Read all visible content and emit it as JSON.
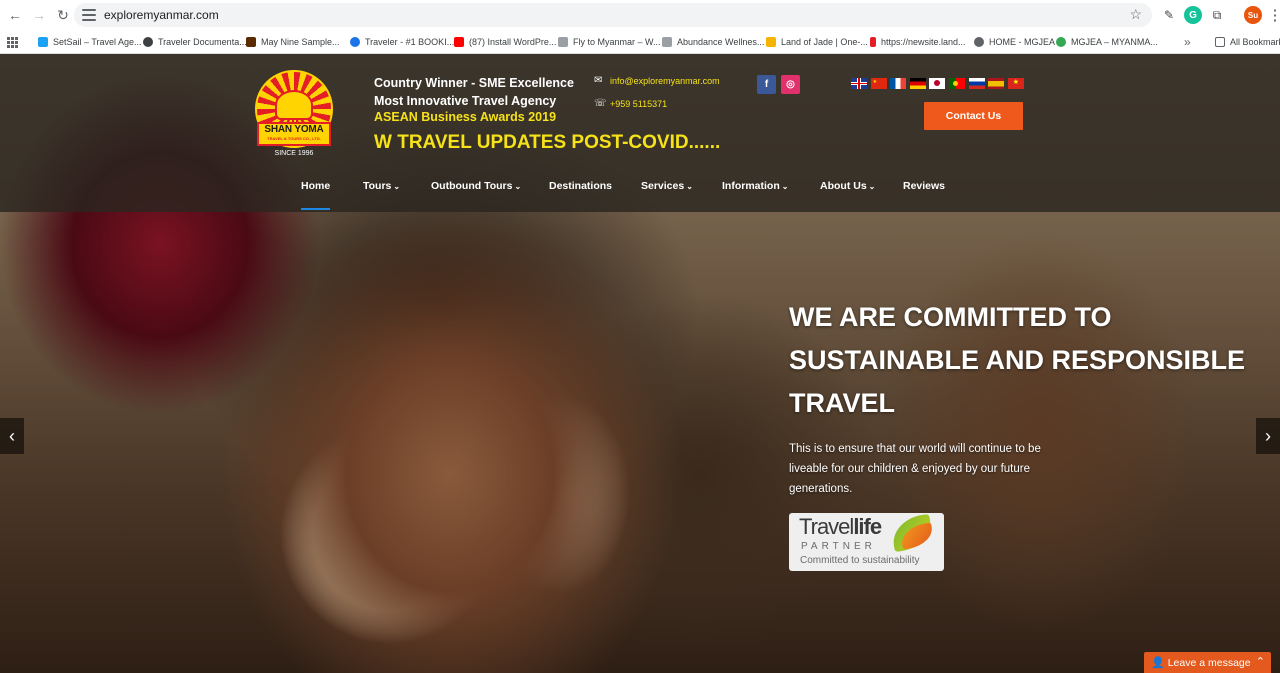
{
  "browser": {
    "url": "exploremyanmar.com",
    "profile_initials": "Su",
    "bookmarks": [
      {
        "label": "SetSail – Travel Age...",
        "color": "#1da1f2"
      },
      {
        "label": "Traveler Documenta...",
        "color": "#3c4043"
      },
      {
        "label": "May Nine Sample...",
        "color": "#5a2a00"
      },
      {
        "label": "Traveler - #1 BOOKI...",
        "color": "#1a73e8"
      },
      {
        "label": "(87) Install WordPre...",
        "color": "#ff0000"
      },
      {
        "label": "Fly to Myanmar – W...",
        "color": "#9aa0a6"
      },
      {
        "label": "Abundance Wellnes...",
        "color": "#9aa0a6"
      },
      {
        "label": "Land of Jade | One-...",
        "color": "#f4b400"
      },
      {
        "label": "https://newsite.land...",
        "color": "#e41e26"
      },
      {
        "label": "HOME - MGJEA",
        "color": "#5f6368"
      },
      {
        "label": "MGJEA – MYANMA...",
        "color": "#34a853"
      }
    ],
    "all_bookmarks_label": "All Bookmarks"
  },
  "header": {
    "logo_brand": "SHAN YOMA",
    "logo_sub": "TRAVEL & TOURS CO., LTD.",
    "logo_since": "SINCE 1996",
    "award_line1": "Country Winner - SME Excellence",
    "award_line2": "Most Innovative Travel Agency",
    "award_line3": "ASEAN Business Awards 2019",
    "covid_marquee": "W TRAVEL UPDATES POST-COVID......",
    "email": "info@exploremyanmar.com",
    "phone": "+959 5115371",
    "contact_button": "Contact Us",
    "flags": [
      "uk-flag-icon",
      "china-flag-icon",
      "france-flag-icon",
      "germany-flag-icon",
      "japan-flag-icon",
      "portugal-flag-icon",
      "russia-flag-icon",
      "spain-flag-icon",
      "vietnam-flag-icon"
    ]
  },
  "nav": {
    "items": [
      {
        "label": "Home",
        "caret": ""
      },
      {
        "label": "Tours",
        "caret": "⌄"
      },
      {
        "label": "Outbound Tours",
        "caret": "⌄"
      },
      {
        "label": "Destinations",
        "caret": ""
      },
      {
        "label": "Services",
        "caret": "⌄"
      },
      {
        "label": "Information",
        "caret": "⌄"
      },
      {
        "label": "About Us",
        "caret": "⌄"
      },
      {
        "label": "Reviews",
        "caret": ""
      }
    ]
  },
  "hero": {
    "headline": "WE ARE COMMITTED TO SUSTAINABLE AND RESPONSIBLE TRAVEL",
    "tagline": "This is to ensure that our world will continue to be liveable for our children & enjoyed by our future generations.",
    "badge_travel": "Travel",
    "badge_life": "life",
    "badge_partner": "PARTNER",
    "badge_commit": "Committed to sustainability"
  },
  "chat": {
    "label": "Leave a message"
  },
  "colors": {
    "accent_orange": "#ef5a1c",
    "award_yellow": "#f5e218",
    "nav_active_underline": "#1e88e5"
  }
}
